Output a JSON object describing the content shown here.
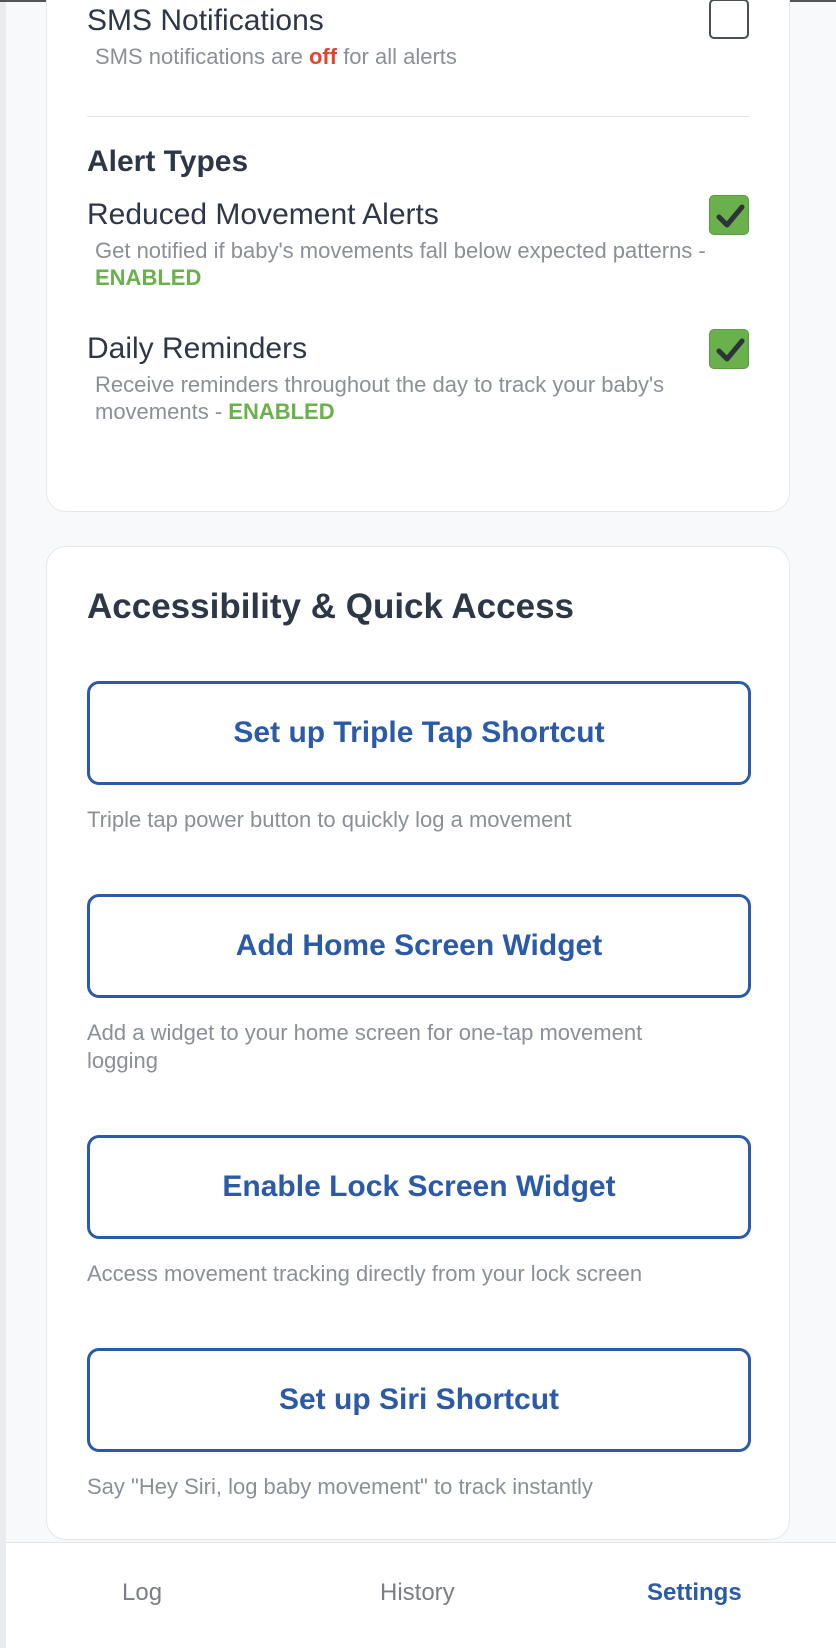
{
  "notifications": {
    "sms": {
      "title": "SMS Notifications",
      "desc_prefix": "SMS notifications are ",
      "desc_state": "off",
      "desc_suffix": " for all alerts"
    },
    "alert_types": {
      "heading": "Alert Types",
      "reduced_movement": {
        "title": "Reduced Movement Alerts",
        "desc": "Get notified if baby's movements fall below expected patterns - ",
        "status": "ENABLED"
      },
      "daily_reminders": {
        "title": "Daily Reminders",
        "desc": "Receive reminders throughout the day to track your baby's movements - ",
        "status": "ENABLED"
      }
    }
  },
  "accessibility": {
    "heading": "Accessibility & Quick Access",
    "triple_tap": {
      "label": "Set up Triple Tap Shortcut",
      "helper": "Triple tap power button to quickly log a movement"
    },
    "home_widget": {
      "label": "Add Home Screen Widget",
      "helper": "Add a widget to your home screen for one-tap movement logging"
    },
    "lock_widget": {
      "label": "Enable Lock Screen Widget",
      "helper": "Access movement tracking directly from your lock screen"
    },
    "siri": {
      "label": "Set up Siri Shortcut",
      "helper": "Say \"Hey Siri, log baby movement\" to track instantly"
    }
  },
  "tabbar": {
    "log": "Log",
    "history": "History",
    "settings": "Settings"
  },
  "colors": {
    "accent": "#2b5aa8",
    "enabled": "#6ab04c",
    "off": "#e2452f"
  }
}
